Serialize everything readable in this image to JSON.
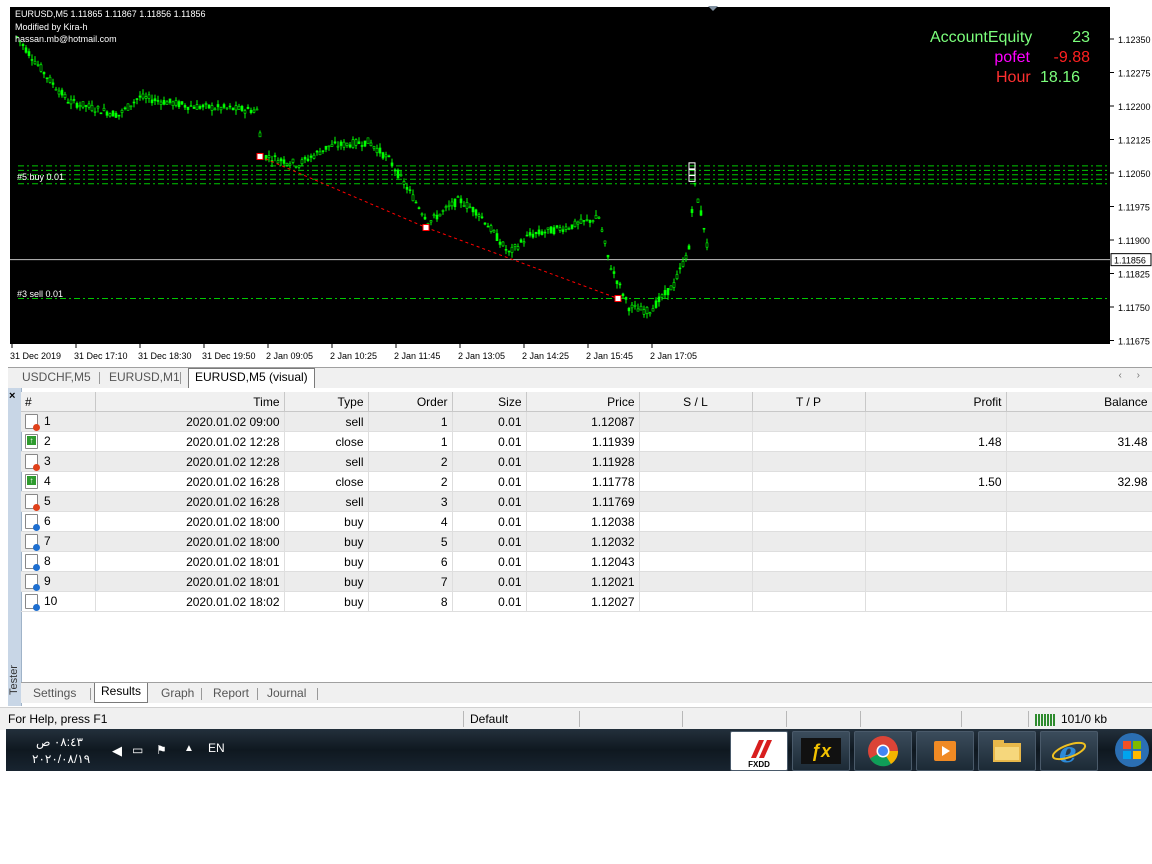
{
  "chart": {
    "symbol_line": "EURUSD,M5  1.11865 1.11867 1.11856 1.11856",
    "modified_by": "Modified by Kira-h",
    "email": "hassan.mb@hotmail.com",
    "account_equity_label": "AccountEquity",
    "account_equity_value": "23",
    "profit_label": "pofet",
    "profit_value": "-9.88",
    "hour_label": "Hour",
    "hour_value": "18.16",
    "order_label_buy": "#5 buy 0.01",
    "order_label_sell": "#3 sell 0.01",
    "current_price": "1.11856",
    "price_ticks": [
      "1.12350",
      "1.12275",
      "1.12200",
      "1.12125",
      "1.12050",
      "1.11975",
      "1.11900",
      "1.11825",
      "1.11750",
      "1.11675"
    ],
    "time_ticks": [
      "31 Dec 2019",
      "31 Dec 17:10",
      "31 Dec 18:30",
      "31 Dec 19:50",
      "2 Jan 09:05",
      "2 Jan 10:25",
      "2 Jan 11:45",
      "2 Jan 13:05",
      "2 Jan 14:25",
      "2 Jan 15:45",
      "2 Jan 17:05"
    ],
    "colors": {
      "background": "#000000",
      "candle": "#00ff00",
      "equity_label": "#7cff7c",
      "profit_label": "#ff00ff",
      "negative": "#ff2020",
      "hour_label": "#ff3030",
      "order_line": "#00c800",
      "trade_line": "#ff0000"
    }
  },
  "chart_data": {
    "type": "line",
    "title": "EURUSD,M5",
    "xlabel": "",
    "ylabel": "",
    "x": [
      "31 Dec 2019",
      "31 Dec 17:10",
      "31 Dec 18:30",
      "31 Dec 19:50",
      "2 Jan 09:05",
      "2 Jan 10:25",
      "2 Jan 11:45",
      "2 Jan 13:05",
      "2 Jan 14:25",
      "2 Jan 15:45",
      "2 Jan 17:05"
    ],
    "ylim": [
      1.1164,
      1.124
    ],
    "series": [
      {
        "name": "",
        "values": [
          1.1236,
          1.1221,
          1.1222,
          1.1219,
          1.1209,
          1.1212,
          1.1194,
          1.1189,
          1.1192,
          1.1185,
          1.1197
        ]
      }
    ]
  },
  "chart_tabs": [
    {
      "label": "USDCHF,M5"
    },
    {
      "label": "EURUSD,M1"
    },
    {
      "label": "EURUSD,M5 (visual)"
    }
  ],
  "tester": {
    "side_label": "Tester",
    "close": "×",
    "columns": [
      "#",
      "Time",
      "Type",
      "Order",
      "Size",
      "Price",
      "S / L",
      "T / P",
      "Profit",
      "Balance"
    ],
    "rows": [
      {
        "n": "1",
        "time": "2020.01.02 09:00",
        "type": "sell",
        "order": "1",
        "size": "0.01",
        "price": "1.12087",
        "sl": "",
        "tp": "",
        "profit": "",
        "balance": ""
      },
      {
        "n": "2",
        "time": "2020.01.02 12:28",
        "type": "close",
        "order": "1",
        "size": "0.01",
        "price": "1.11939",
        "sl": "",
        "tp": "",
        "profit": "1.48",
        "balance": "31.48"
      },
      {
        "n": "3",
        "time": "2020.01.02 12:28",
        "type": "sell",
        "order": "2",
        "size": "0.01",
        "price": "1.11928",
        "sl": "",
        "tp": "",
        "profit": "",
        "balance": ""
      },
      {
        "n": "4",
        "time": "2020.01.02 16:28",
        "type": "close",
        "order": "2",
        "size": "0.01",
        "price": "1.11778",
        "sl": "",
        "tp": "",
        "profit": "1.50",
        "balance": "32.98"
      },
      {
        "n": "5",
        "time": "2020.01.02 16:28",
        "type": "sell",
        "order": "3",
        "size": "0.01",
        "price": "1.11769",
        "sl": "",
        "tp": "",
        "profit": "",
        "balance": ""
      },
      {
        "n": "6",
        "time": "2020.01.02 18:00",
        "type": "buy",
        "order": "4",
        "size": "0.01",
        "price": "1.12038",
        "sl": "",
        "tp": "",
        "profit": "",
        "balance": ""
      },
      {
        "n": "7",
        "time": "2020.01.02 18:00",
        "type": "buy",
        "order": "5",
        "size": "0.01",
        "price": "1.12032",
        "sl": "",
        "tp": "",
        "profit": "",
        "balance": ""
      },
      {
        "n": "8",
        "time": "2020.01.02 18:01",
        "type": "buy",
        "order": "6",
        "size": "0.01",
        "price": "1.12043",
        "sl": "",
        "tp": "",
        "profit": "",
        "balance": ""
      },
      {
        "n": "9",
        "time": "2020.01.02 18:01",
        "type": "buy",
        "order": "7",
        "size": "0.01",
        "price": "1.12021",
        "sl": "",
        "tp": "",
        "profit": "",
        "balance": ""
      },
      {
        "n": "10",
        "time": "2020.01.02 18:02",
        "type": "buy",
        "order": "8",
        "size": "0.01",
        "price": "1.12027",
        "sl": "",
        "tp": "",
        "profit": "",
        "balance": ""
      }
    ],
    "bottom_tabs": [
      "Settings",
      "Results",
      "Graph",
      "Report",
      "Journal"
    ]
  },
  "statusbar": {
    "help": "For Help, press F1",
    "profile": "Default",
    "traffic": "101/0 kb"
  },
  "taskbar": {
    "time": "٠٨:٤٣ ص",
    "date": "٢٠٢٠/٠٨/١٩",
    "lang": "EN",
    "fxdd": "FXDD"
  }
}
